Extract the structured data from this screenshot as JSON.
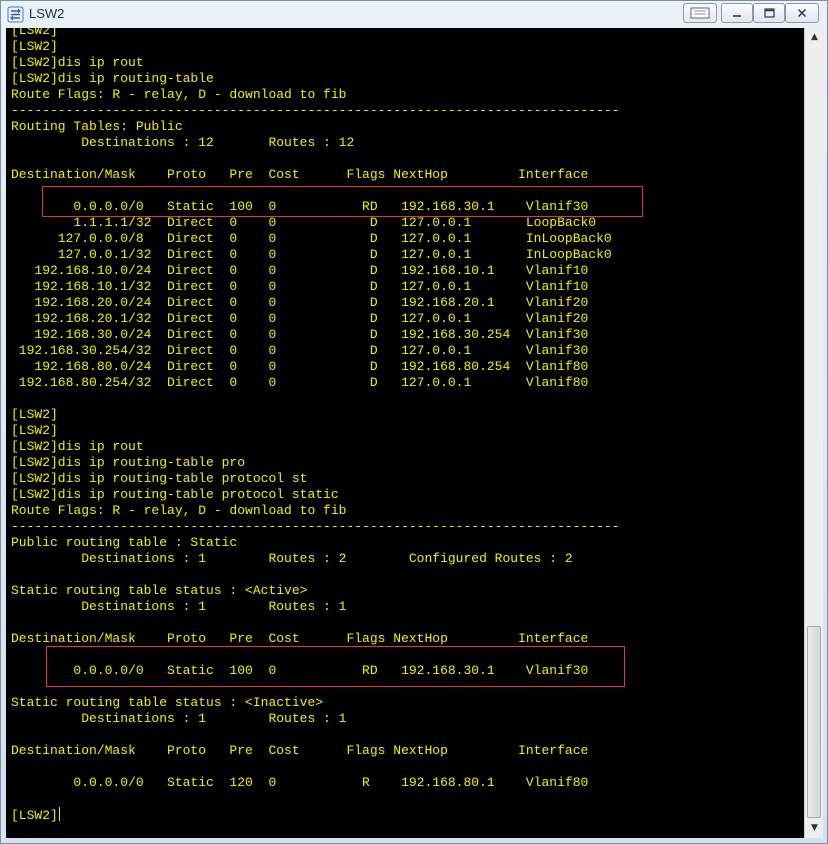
{
  "window": {
    "title": "LSW2",
    "controls": {
      "options": "options",
      "minimize": "—",
      "maximize": "☐",
      "close": "✕"
    }
  },
  "colors": {
    "terminal_bg": "#000000",
    "terminal_text": "#f0f000",
    "highlight": "#e0353d"
  },
  "terminal": {
    "lines": [
      "[LSW2]",
      "[LSW2]",
      "[LSW2]dis ip rout",
      "[LSW2]dis ip routing-table",
      "Route Flags: R - relay, D - download to fib",
      "------------------------------------------------------------------------------",
      "Routing Tables: Public",
      "         Destinations : 12       Routes : 12",
      "",
      "Destination/Mask    Proto   Pre  Cost      Flags NextHop         Interface",
      "",
      "        0.0.0.0/0   Static  100  0           RD   192.168.30.1    Vlanif30",
      "        1.1.1.1/32  Direct  0    0            D   127.0.0.1       LoopBack0",
      "      127.0.0.0/8   Direct  0    0            D   127.0.0.1       InLoopBack0",
      "      127.0.0.1/32  Direct  0    0            D   127.0.0.1       InLoopBack0",
      "   192.168.10.0/24  Direct  0    0            D   192.168.10.1    Vlanif10",
      "   192.168.10.1/32  Direct  0    0            D   127.0.0.1       Vlanif10",
      "   192.168.20.0/24  Direct  0    0            D   192.168.20.1    Vlanif20",
      "   192.168.20.1/32  Direct  0    0            D   127.0.0.1       Vlanif20",
      "   192.168.30.0/24  Direct  0    0            D   192.168.30.254  Vlanif30",
      " 192.168.30.254/32  Direct  0    0            D   127.0.0.1       Vlanif30",
      "   192.168.80.0/24  Direct  0    0            D   192.168.80.254  Vlanif80",
      " 192.168.80.254/32  Direct  0    0            D   127.0.0.1       Vlanif80",
      "",
      "[LSW2]",
      "[LSW2]",
      "[LSW2]dis ip rout",
      "[LSW2]dis ip routing-table pro",
      "[LSW2]dis ip routing-table protocol st",
      "[LSW2]dis ip routing-table protocol static",
      "Route Flags: R - relay, D - download to fib",
      "------------------------------------------------------------------------------",
      "Public routing table : Static",
      "         Destinations : 1        Routes : 2        Configured Routes : 2",
      "",
      "Static routing table status : <Active>",
      "         Destinations : 1        Routes : 1",
      "",
      "Destination/Mask    Proto   Pre  Cost      Flags NextHop         Interface",
      "",
      "        0.0.0.0/0   Static  100  0           RD   192.168.30.1    Vlanif30",
      "",
      "Static routing table status : <Inactive>",
      "         Destinations : 1        Routes : 1",
      "",
      "Destination/Mask    Proto   Pre  Cost      Flags NextHop         Interface",
      "",
      "        0.0.0.0/0   Static  120  0           R    192.168.80.1    Vlanif80",
      "",
      "[LSW2]"
    ]
  }
}
